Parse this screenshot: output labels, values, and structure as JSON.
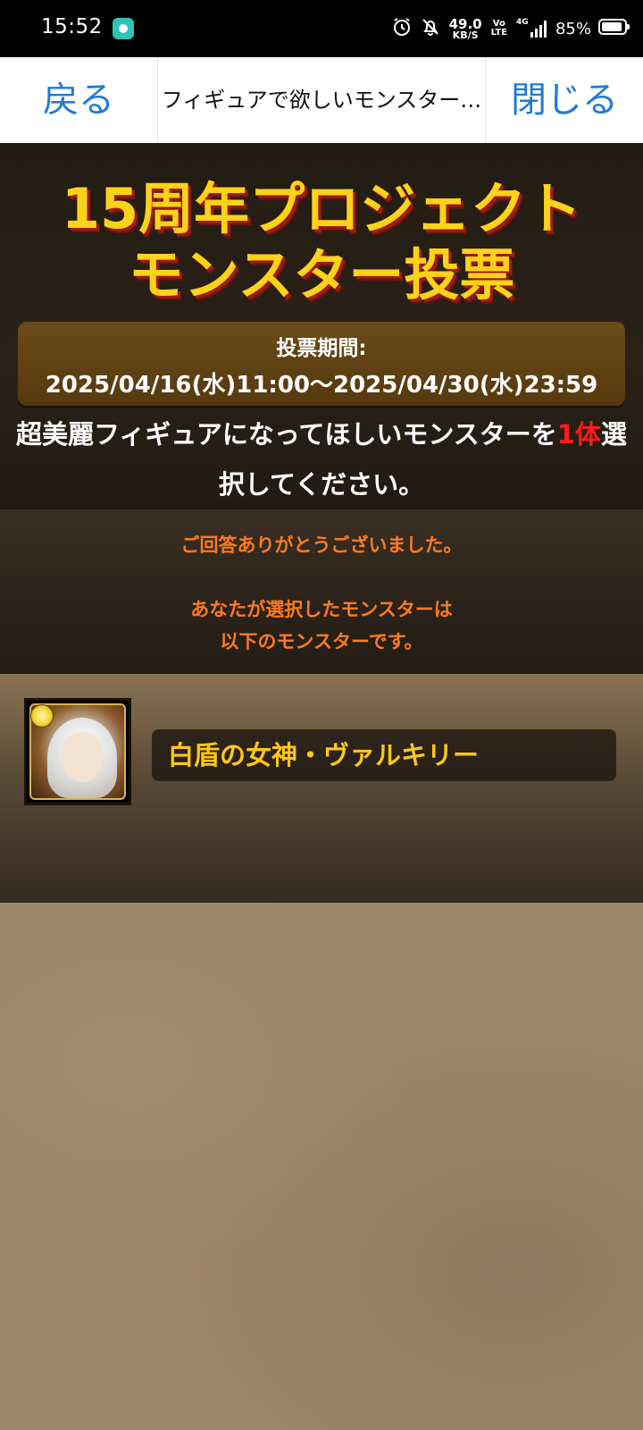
{
  "status_bar": {
    "time": "15:52",
    "net_speed_value": "49.0",
    "net_speed_unit": "KB/S",
    "volte_top": "Vo",
    "volte_bottom": "LTE",
    "network_type": "4G",
    "battery_percent": "85%",
    "icons": [
      "app-icon",
      "alarm-icon",
      "bell-off-icon",
      "signal-icon",
      "battery-icon"
    ]
  },
  "nav": {
    "back_label": "戻る",
    "title": "フィギュアで欲しいモンスター…",
    "close_label": "閉じる",
    "accent_color": "#1f7ad8"
  },
  "header": {
    "title_line1": "15周年プロジェクト",
    "title_line2": "モンスター投票",
    "period_label": "投票期間:",
    "period_value": "2025/04/16(水)11:00〜2025/04/30(水)23:59",
    "instruction_part1": "超美麗フィギュアになってほしいモンスターを",
    "instruction_red": "1体",
    "instruction_part2": "選択してください。"
  },
  "thanks": {
    "line1": "ご回答ありがとうございました。",
    "line2": "あなたが選択したモンスターは",
    "line3": "以下のモンスターです。"
  },
  "selected_monster": {
    "name": "白盾の女神・ヴァルキリー",
    "icon": "monster-portrait-valkyrie",
    "attribute": "light"
  }
}
